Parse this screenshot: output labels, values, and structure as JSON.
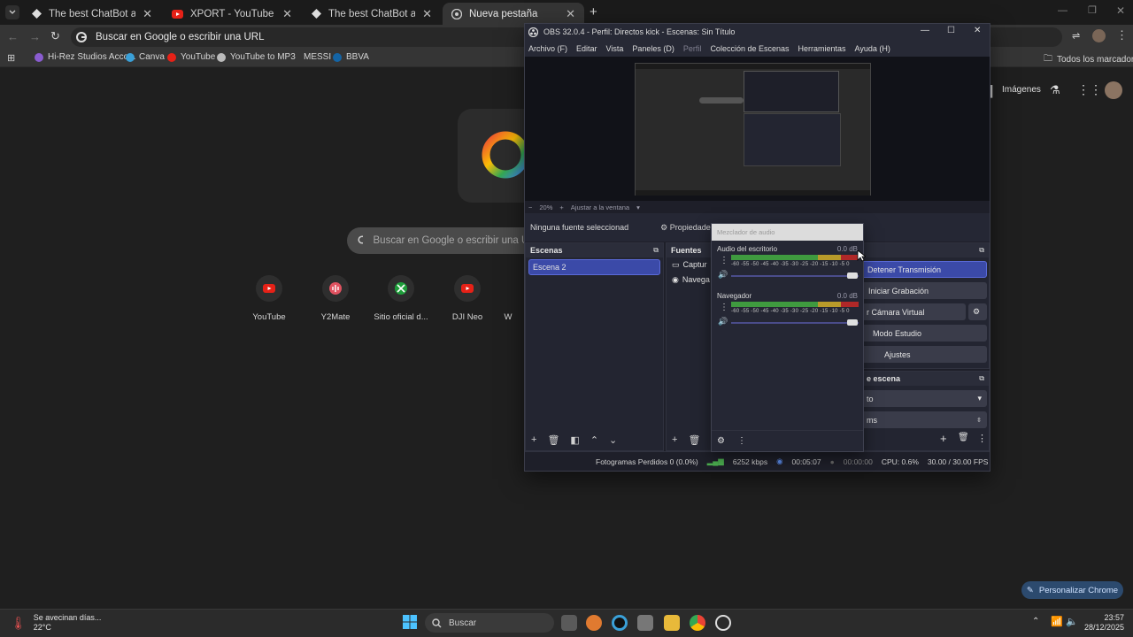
{
  "chrome": {
    "tabs": [
      {
        "title": "The best ChatBot and Widgets",
        "icon": "botrix-icon"
      },
      {
        "title": "XPORT - YouTube",
        "icon": "youtube-icon"
      },
      {
        "title": "The best ChatBot and Widgets",
        "icon": "botrix-icon"
      },
      {
        "title": "Nueva pestaña",
        "icon": "chrome-icon",
        "active": true
      }
    ],
    "omnibox_placeholder": "Buscar en Google o escribir una URL",
    "bookmarks": [
      "Hi-Rez Studios Acco...",
      "Canva",
      "YouTube",
      "YouTube to MP3",
      "MESSI",
      "BBVA"
    ],
    "all_bookmarks": "Todos los marcadores"
  },
  "ntp": {
    "images_link": "Imágenes",
    "search_placeholder": "Buscar en Google o escribir una URL",
    "shortcuts": [
      "YouTube",
      "Y2Mate",
      "Sitio oficial d...",
      "DJI Neo",
      "W"
    ],
    "customize": "Personalizar Chrome"
  },
  "obs": {
    "title": "OBS 32.0.4 - Perfil: Directos kick - Escenas: Sin Título",
    "menu": [
      "Archivo (F)",
      "Editar",
      "Vista",
      "Paneles (D)",
      "Perfil",
      "Colección de Escenas",
      "Herramientas",
      "Ayuda (H)"
    ],
    "zoom": "20%",
    "fit": "Ajustar a la ventana",
    "no_source": "Ninguna fuente seleccionad",
    "properties": "Propiedades",
    "scenes_title": "Escenas",
    "scenes": [
      "Escena 2"
    ],
    "sources_title": "Fuentes",
    "sources": [
      "Captur",
      "Navega"
    ],
    "controls": [
      "Detener Transmisión",
      "Iniciar Grabación",
      "r Cámara Virtual",
      "Modo Estudio",
      "Ajustes"
    ],
    "transitions_title": "e escena",
    "transition_values": [
      "to",
      "ms"
    ],
    "status": {
      "dropped": "Fotogramas Perdidos 0 (0.0%)",
      "bitrate": "6252 kbps",
      "stream_time": "00:05:07",
      "rec_time": "00:00:00",
      "cpu": "CPU: 0.6%",
      "fps": "30.00 / 30.00 FPS"
    },
    "mixer": {
      "title": "Mezclador de audio",
      "channels": [
        {
          "name": "Audio del escritorio",
          "db": "0.0 dB"
        },
        {
          "name": "Navegador",
          "db": "0.0 dB"
        }
      ],
      "scale": "-60 -55 -50 -45 -40 -35 -30 -25 -20 -15 -10 -5 0"
    }
  },
  "taskbar": {
    "weather_text": "Se avecinan días...",
    "weather_temp": "22°C",
    "search": "Buscar",
    "time": "23:57",
    "date": "28/12/2025"
  },
  "colors": {
    "accent": "#3b5bd0",
    "chrome_bg": "#1f1f1f",
    "obs_bg": "#1e1f29"
  }
}
